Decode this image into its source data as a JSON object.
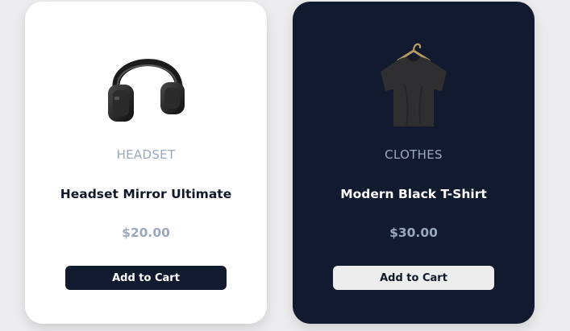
{
  "products": [
    {
      "icon": "headphones-icon",
      "category": "HEADSET",
      "title": "Headset Mirror Ultimate",
      "price": "$20.00",
      "button_label": "Add to Cart"
    },
    {
      "icon": "t-shirt-icon",
      "category": "CLOTHES",
      "title": "Modern Black T-Shirt",
      "price": "$30.00",
      "button_label": "Add to Cart"
    }
  ],
  "colors": {
    "dark_card": "#111a2e",
    "accent_muted": "#9aa8be",
    "light_card": "#ffffff"
  }
}
